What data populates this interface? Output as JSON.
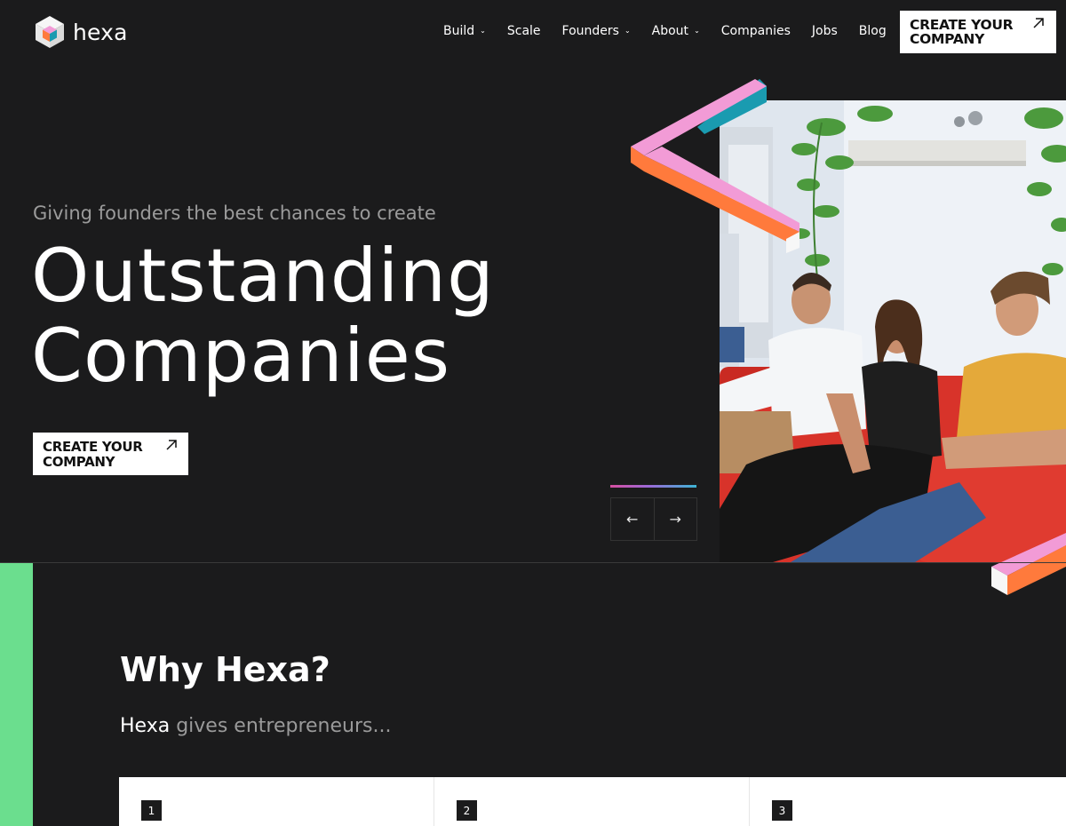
{
  "header": {
    "logo_text": "hexa",
    "nav": [
      {
        "label": "Build",
        "has_dropdown": true
      },
      {
        "label": "Scale",
        "has_dropdown": false
      },
      {
        "label": "Founders",
        "has_dropdown": true
      },
      {
        "label": "About",
        "has_dropdown": true
      },
      {
        "label": "Companies",
        "has_dropdown": false
      },
      {
        "label": "Jobs",
        "has_dropdown": false
      },
      {
        "label": "Blog",
        "has_dropdown": false
      }
    ],
    "cta_label": "CREATE YOUR COMPANY",
    "cta_icon": "arrow-up-right-icon"
  },
  "hero": {
    "subtitle": "Giving founders the best chances to create",
    "title_line1": "Outstanding",
    "title_line2": "Companies",
    "cta_label": "CREATE YOUR COMPANY",
    "prev_icon": "arrow-left-icon",
    "next_icon": "arrow-right-icon",
    "prev_glyph": "←",
    "next_glyph": "→"
  },
  "why": {
    "title": "Why Hexa?",
    "subtitle_brand": "Hexa",
    "subtitle_rest": " gives entrepreneurs...",
    "cards": [
      {
        "number": "1"
      },
      {
        "number": "2"
      },
      {
        "number": "3"
      }
    ]
  },
  "colors": {
    "background": "#1b1b1c",
    "accent_green": "#6bde8e",
    "accent_pink": "#f29bd6",
    "accent_orange": "#ff7a3c",
    "accent_teal": "#1a9bb0",
    "muted_text": "#9b9b9b"
  }
}
